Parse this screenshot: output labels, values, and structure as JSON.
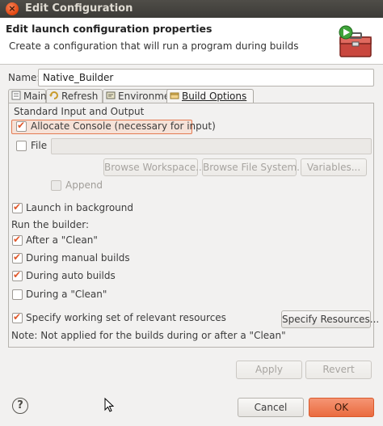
{
  "window": {
    "title": "Edit Configuration"
  },
  "header": {
    "title": "Edit launch configuration properties",
    "description": "Create a configuration that will run a program during builds"
  },
  "name": {
    "label": "Name:",
    "value": "Native_Builder"
  },
  "tabs": [
    {
      "label": "Main",
      "icon": "main-tab-icon",
      "active": false
    },
    {
      "label": "Refresh",
      "icon": "refresh-icon",
      "active": false
    },
    {
      "label": "Environment",
      "icon": "environment-icon",
      "active": false
    },
    {
      "label": "Build Options",
      "icon": "build-options-icon",
      "active": true
    }
  ],
  "build_options": {
    "std_io_group_label": "Standard Input and Output",
    "allocate_console": {
      "label": "Allocate Console (necessary for input)",
      "checked": true
    },
    "file": {
      "label": "File",
      "checked": false,
      "value": ""
    },
    "browse_workspace_label": "Browse Workspace...",
    "browse_file_system_label": "Browse File System...",
    "variables_label": "Variables...",
    "append": {
      "label": "Append",
      "checked": false
    },
    "launch_background": {
      "label": "Launch in background",
      "checked": true
    },
    "run_builder_label": "Run the builder:",
    "after_clean": {
      "label": "After a \"Clean\"",
      "checked": true
    },
    "manual_builds": {
      "label": "During manual builds",
      "checked": true
    },
    "auto_builds": {
      "label": "During auto builds",
      "checked": true
    },
    "during_clean": {
      "label": "During a \"Clean\"",
      "checked": false
    },
    "working_set": {
      "label": "Specify working set of relevant resources",
      "checked": true
    },
    "specify_resources_label": "Specify Resources...",
    "note": "Note: Not applied for the builds during or after a \"Clean\""
  },
  "buttons": {
    "apply": "Apply",
    "revert": "Revert",
    "cancel": "Cancel",
    "ok": "OK",
    "help": "?"
  },
  "colors": {
    "accent": "#ea6b3f",
    "checkmark": "#e0582b",
    "titlebar": "#3c3b37"
  }
}
